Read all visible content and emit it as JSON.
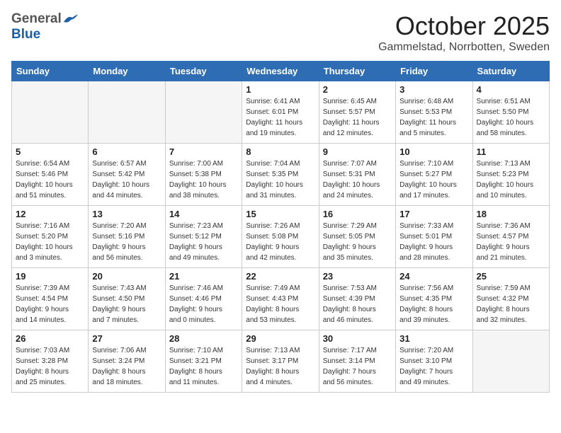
{
  "header": {
    "logo_general": "General",
    "logo_blue": "Blue",
    "month": "October 2025",
    "location": "Gammelstad, Norrbotten, Sweden"
  },
  "weekdays": [
    "Sunday",
    "Monday",
    "Tuesday",
    "Wednesday",
    "Thursday",
    "Friday",
    "Saturday"
  ],
  "weeks": [
    [
      {
        "day": "",
        "info": ""
      },
      {
        "day": "",
        "info": ""
      },
      {
        "day": "",
        "info": ""
      },
      {
        "day": "1",
        "info": "Sunrise: 6:41 AM\nSunset: 6:01 PM\nDaylight: 11 hours\nand 19 minutes."
      },
      {
        "day": "2",
        "info": "Sunrise: 6:45 AM\nSunset: 5:57 PM\nDaylight: 11 hours\nand 12 minutes."
      },
      {
        "day": "3",
        "info": "Sunrise: 6:48 AM\nSunset: 5:53 PM\nDaylight: 11 hours\nand 5 minutes."
      },
      {
        "day": "4",
        "info": "Sunrise: 6:51 AM\nSunset: 5:50 PM\nDaylight: 10 hours\nand 58 minutes."
      }
    ],
    [
      {
        "day": "5",
        "info": "Sunrise: 6:54 AM\nSunset: 5:46 PM\nDaylight: 10 hours\nand 51 minutes."
      },
      {
        "day": "6",
        "info": "Sunrise: 6:57 AM\nSunset: 5:42 PM\nDaylight: 10 hours\nand 44 minutes."
      },
      {
        "day": "7",
        "info": "Sunrise: 7:00 AM\nSunset: 5:38 PM\nDaylight: 10 hours\nand 38 minutes."
      },
      {
        "day": "8",
        "info": "Sunrise: 7:04 AM\nSunset: 5:35 PM\nDaylight: 10 hours\nand 31 minutes."
      },
      {
        "day": "9",
        "info": "Sunrise: 7:07 AM\nSunset: 5:31 PM\nDaylight: 10 hours\nand 24 minutes."
      },
      {
        "day": "10",
        "info": "Sunrise: 7:10 AM\nSunset: 5:27 PM\nDaylight: 10 hours\nand 17 minutes."
      },
      {
        "day": "11",
        "info": "Sunrise: 7:13 AM\nSunset: 5:23 PM\nDaylight: 10 hours\nand 10 minutes."
      }
    ],
    [
      {
        "day": "12",
        "info": "Sunrise: 7:16 AM\nSunset: 5:20 PM\nDaylight: 10 hours\nand 3 minutes."
      },
      {
        "day": "13",
        "info": "Sunrise: 7:20 AM\nSunset: 5:16 PM\nDaylight: 9 hours\nand 56 minutes."
      },
      {
        "day": "14",
        "info": "Sunrise: 7:23 AM\nSunset: 5:12 PM\nDaylight: 9 hours\nand 49 minutes."
      },
      {
        "day": "15",
        "info": "Sunrise: 7:26 AM\nSunset: 5:08 PM\nDaylight: 9 hours\nand 42 minutes."
      },
      {
        "day": "16",
        "info": "Sunrise: 7:29 AM\nSunset: 5:05 PM\nDaylight: 9 hours\nand 35 minutes."
      },
      {
        "day": "17",
        "info": "Sunrise: 7:33 AM\nSunset: 5:01 PM\nDaylight: 9 hours\nand 28 minutes."
      },
      {
        "day": "18",
        "info": "Sunrise: 7:36 AM\nSunset: 4:57 PM\nDaylight: 9 hours\nand 21 minutes."
      }
    ],
    [
      {
        "day": "19",
        "info": "Sunrise: 7:39 AM\nSunset: 4:54 PM\nDaylight: 9 hours\nand 14 minutes."
      },
      {
        "day": "20",
        "info": "Sunrise: 7:43 AM\nSunset: 4:50 PM\nDaylight: 9 hours\nand 7 minutes."
      },
      {
        "day": "21",
        "info": "Sunrise: 7:46 AM\nSunset: 4:46 PM\nDaylight: 9 hours\nand 0 minutes."
      },
      {
        "day": "22",
        "info": "Sunrise: 7:49 AM\nSunset: 4:43 PM\nDaylight: 8 hours\nand 53 minutes."
      },
      {
        "day": "23",
        "info": "Sunrise: 7:53 AM\nSunset: 4:39 PM\nDaylight: 8 hours\nand 46 minutes."
      },
      {
        "day": "24",
        "info": "Sunrise: 7:56 AM\nSunset: 4:35 PM\nDaylight: 8 hours\nand 39 minutes."
      },
      {
        "day": "25",
        "info": "Sunrise: 7:59 AM\nSunset: 4:32 PM\nDaylight: 8 hours\nand 32 minutes."
      }
    ],
    [
      {
        "day": "26",
        "info": "Sunrise: 7:03 AM\nSunset: 3:28 PM\nDaylight: 8 hours\nand 25 minutes."
      },
      {
        "day": "27",
        "info": "Sunrise: 7:06 AM\nSunset: 3:24 PM\nDaylight: 8 hours\nand 18 minutes."
      },
      {
        "day": "28",
        "info": "Sunrise: 7:10 AM\nSunset: 3:21 PM\nDaylight: 8 hours\nand 11 minutes."
      },
      {
        "day": "29",
        "info": "Sunrise: 7:13 AM\nSunset: 3:17 PM\nDaylight: 8 hours\nand 4 minutes."
      },
      {
        "day": "30",
        "info": "Sunrise: 7:17 AM\nSunset: 3:14 PM\nDaylight: 7 hours\nand 56 minutes."
      },
      {
        "day": "31",
        "info": "Sunrise: 7:20 AM\nSunset: 3:10 PM\nDaylight: 7 hours\nand 49 minutes."
      },
      {
        "day": "",
        "info": ""
      }
    ]
  ]
}
